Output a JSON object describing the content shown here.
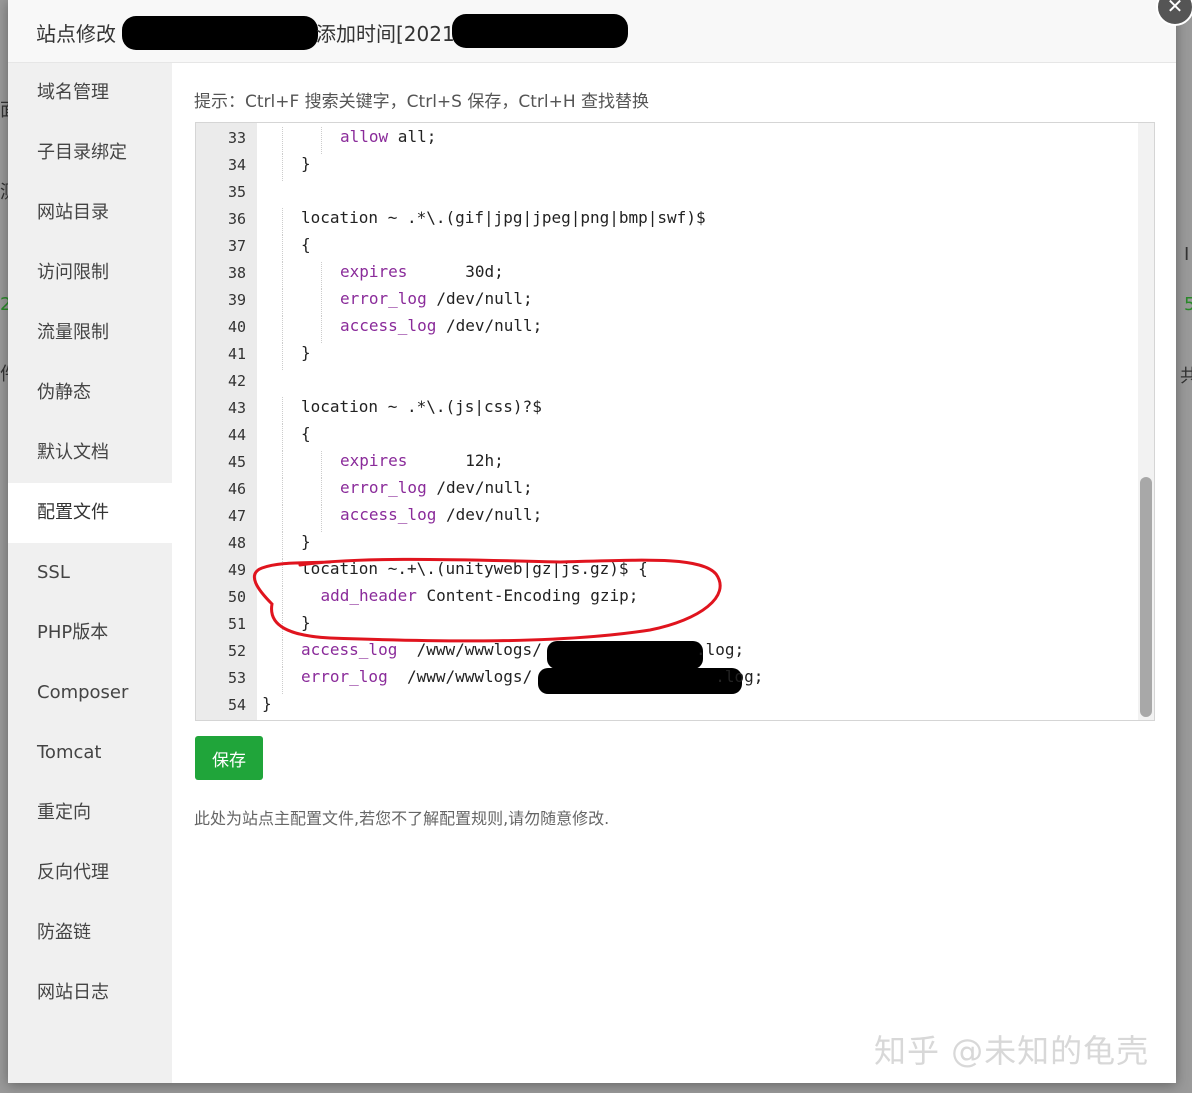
{
  "modal": {
    "title": "站点修改",
    "title_added": "添加时间[2021",
    "close_glyph": "✕"
  },
  "background_fragments": [
    "面",
    "测",
    "2",
    "件",
    "I",
    "5",
    "共"
  ],
  "sidebar": {
    "items": [
      {
        "label": "域名管理"
      },
      {
        "label": "子目录绑定"
      },
      {
        "label": "网站目录"
      },
      {
        "label": "访问限制"
      },
      {
        "label": "流量限制"
      },
      {
        "label": "伪静态"
      },
      {
        "label": "默认文档"
      },
      {
        "label": "配置文件",
        "active": true
      },
      {
        "label": "SSL"
      },
      {
        "label": "PHP版本"
      },
      {
        "label": "Composer"
      },
      {
        "label": "Tomcat"
      },
      {
        "label": "重定向"
      },
      {
        "label": "反向代理"
      },
      {
        "label": "防盗链"
      },
      {
        "label": "网站日志"
      }
    ]
  },
  "tip": "提示：Ctrl+F 搜索关键字，Ctrl+S 保存，Ctrl+H 查找替换",
  "editor": {
    "lines": [
      {
        "n": "33",
        "text": "allow all;"
      },
      {
        "n": "34",
        "text": "}"
      },
      {
        "n": "35",
        "text": ""
      },
      {
        "n": "36",
        "text": "location ~ .*\\.(gif|jpg|jpeg|png|bmp|swf)$"
      },
      {
        "n": "37",
        "text": "{"
      },
      {
        "n": "38",
        "text": "expires      30d;"
      },
      {
        "n": "39",
        "text": "error_log /dev/null;"
      },
      {
        "n": "40",
        "text": "access_log /dev/null;"
      },
      {
        "n": "41",
        "text": "}"
      },
      {
        "n": "42",
        "text": ""
      },
      {
        "n": "43",
        "text": "location ~ .*\\.(js|css)?$"
      },
      {
        "n": "44",
        "text": "{"
      },
      {
        "n": "45",
        "text": "expires      12h;"
      },
      {
        "n": "46",
        "text": "error_log /dev/null;"
      },
      {
        "n": "47",
        "text": "access_log /dev/null;"
      },
      {
        "n": "48",
        "text": "}"
      },
      {
        "n": "49",
        "text": "location ~.+\\.(unityweb|gz|js.gz)$ {"
      },
      {
        "n": "50",
        "text": "add_header Content-Encoding gzip;"
      },
      {
        "n": "51",
        "text": "}"
      },
      {
        "n": "52",
        "text": "access_log  /www/wwwlogs/                .log;"
      },
      {
        "n": "53",
        "text": "error_log  /www/wwwlogs/                   .log;"
      },
      {
        "n": "54",
        "text": "}"
      }
    ]
  },
  "save_label": "保存",
  "note": "此处为站点主配置文件,若您不了解配置规则,请勿随意修改.",
  "watermark": "知乎 @未知的龟壳",
  "colors": {
    "accent": "#20a53a",
    "keyword": "#8a2b9a",
    "annotation": "#e0141e"
  }
}
